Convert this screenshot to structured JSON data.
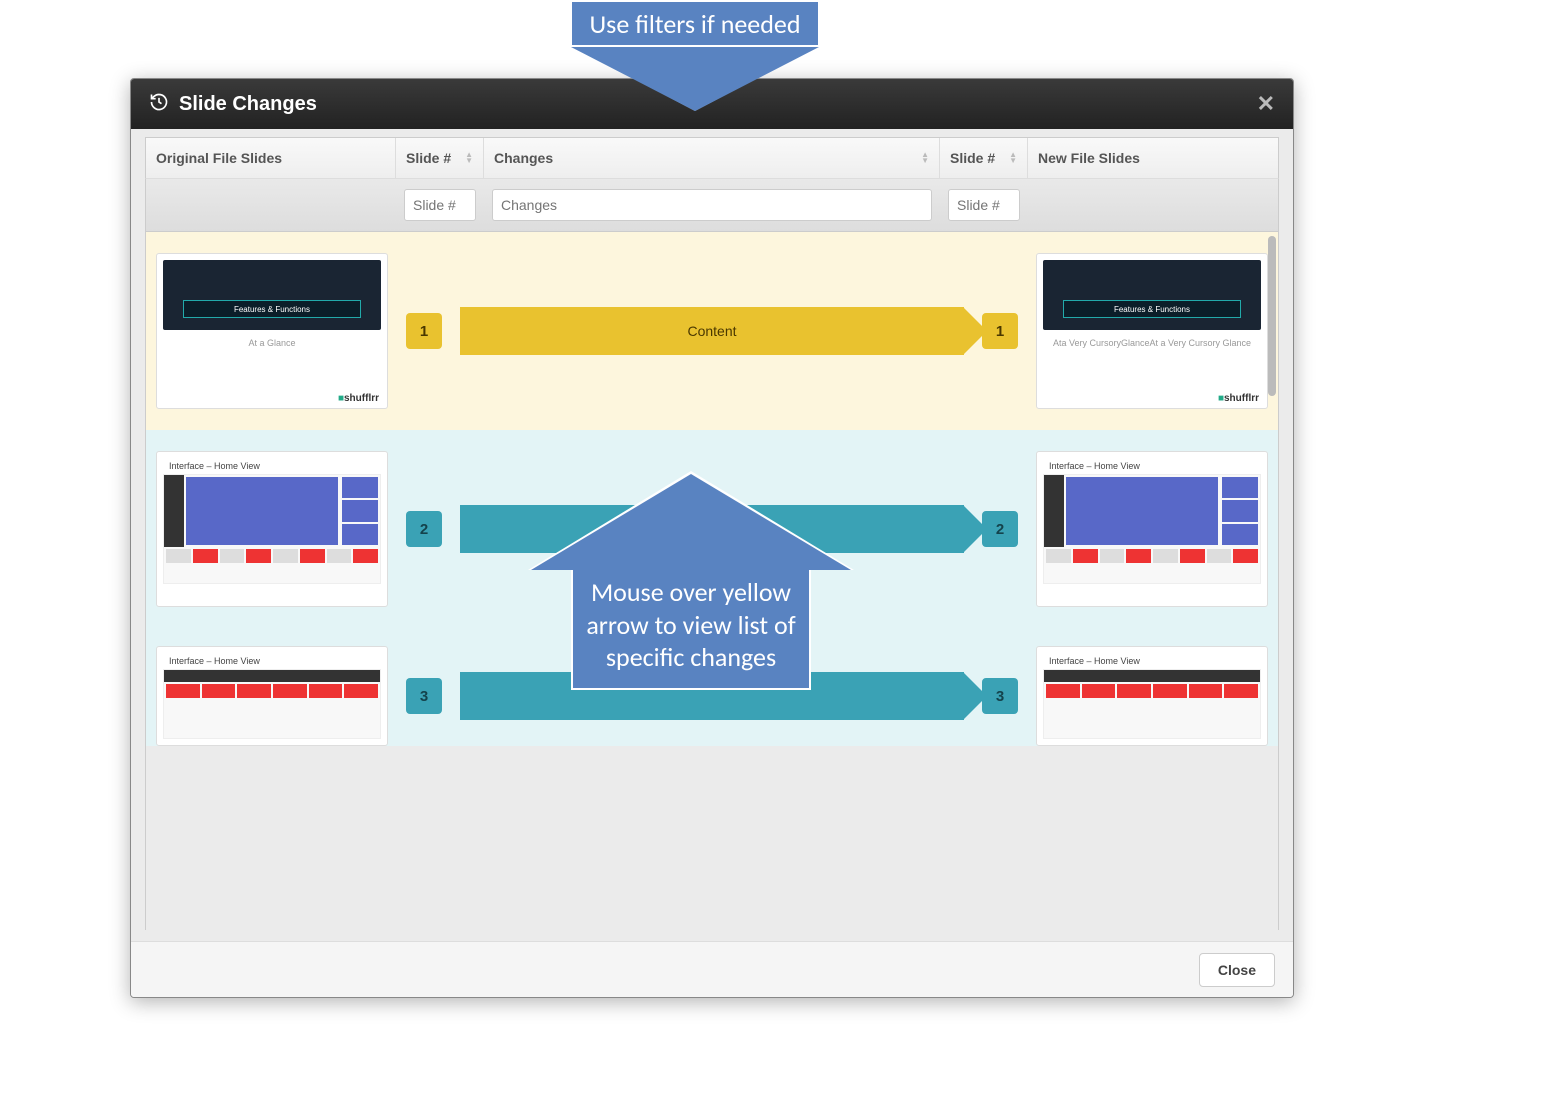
{
  "dialog": {
    "title": "Slide Changes",
    "close_button": "Close"
  },
  "columns": {
    "original": "Original File Slides",
    "slide_num_left": "Slide #",
    "changes": "Changes",
    "slide_num_right": "Slide #",
    "new": "New File Slides"
  },
  "filters": {
    "slide_num_left_placeholder": "Slide #",
    "changes_placeholder": "Changes",
    "slide_num_right_placeholder": "Slide #"
  },
  "rows": [
    {
      "orig_num": "1",
      "new_num": "1",
      "change_label": "Content",
      "orig_thumb": {
        "title": "Features & Functions",
        "subtitle": "At a Glance",
        "brand": "shufflrr"
      },
      "new_thumb": {
        "title": "Features & Functions",
        "subtitle": "Ata Very CursoryGlanceAt a Very Cursory Glance",
        "brand": "shufflrr"
      }
    },
    {
      "orig_num": "2",
      "new_num": "2",
      "change_label": "",
      "orig_thumb": {
        "title": "Interface – Home View"
      },
      "new_thumb": {
        "title": "Interface – Home View"
      }
    },
    {
      "orig_num": "3",
      "new_num": "3",
      "change_label": "",
      "orig_thumb": {
        "title": "Interface – Home View"
      },
      "new_thumb": {
        "title": "Interface – Home View"
      }
    }
  ],
  "callouts": {
    "top": "Use filters if needed",
    "bottom": "Mouse over yellow arrow to view list of specific changes"
  }
}
